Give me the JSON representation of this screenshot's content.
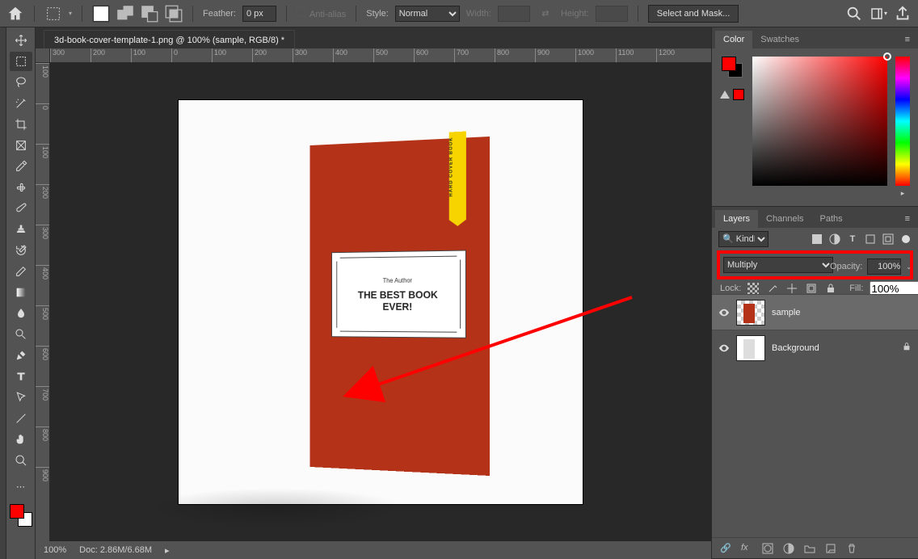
{
  "topbar": {
    "feather_label": "Feather:",
    "feather_value": "0 px",
    "antialias_label": "Anti-alias",
    "style_label": "Style:",
    "style_value": "Normal",
    "width_label": "Width:",
    "height_label": "Height:",
    "select_mask": "Select and Mask..."
  },
  "document": {
    "tab_title": "3d-book-cover-template-1.png @ 100% (sample, RGB/8) *"
  },
  "ruler_h": [
    "300",
    "200",
    "100",
    "0",
    "100",
    "200",
    "300",
    "400",
    "500",
    "600",
    "700",
    "800",
    "900",
    "1000",
    "1100",
    "1200"
  ],
  "ruler_v": [
    "100",
    "0",
    "100",
    "200",
    "300",
    "400",
    "500",
    "600",
    "700",
    "800",
    "900"
  ],
  "canvas": {
    "ribbon_text": "HARD COVER BOOK",
    "author": "The Author",
    "book_title_l1": "THE BEST BOOK",
    "book_title_l2": "EVER!"
  },
  "status": {
    "zoom": "100%",
    "doc": "Doc: 2.86M/6.68M"
  },
  "panel_color": {
    "tab_color": "Color",
    "tab_swatches": "Swatches"
  },
  "panel_layers": {
    "tab_layers": "Layers",
    "tab_channels": "Channels",
    "tab_paths": "Paths",
    "kind_label": "Kind",
    "blend_value": "Multiply",
    "opacity_label": "Opacity:",
    "opacity_value": "100%",
    "lock_label": "Lock:",
    "fill_label": "Fill:",
    "fill_value": "100%",
    "layer1": "sample",
    "layer2": "Background"
  }
}
